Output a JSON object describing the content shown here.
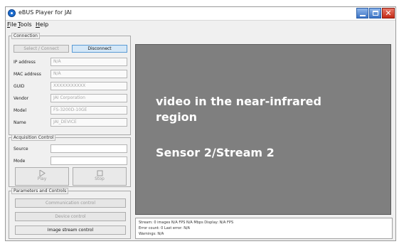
{
  "window": {
    "title": "eBUS Player for JAI"
  },
  "menu": {
    "file": "File",
    "tools": "Tools",
    "help": "Help"
  },
  "connection": {
    "title": "Connection",
    "select_connect": "Select / Connect",
    "disconnect": "Disconnect",
    "fields": [
      {
        "label": "IP address",
        "value": "N/A"
      },
      {
        "label": "MAC address",
        "value": "N/A"
      },
      {
        "label": "GUID",
        "value": "XXXXXXXXXXX"
      },
      {
        "label": "Vendor",
        "value": "JAI Corporation"
      },
      {
        "label": "Model",
        "value": "FS-3200D-10GE"
      },
      {
        "label": "Name",
        "value": "JAI_DEVICE"
      }
    ]
  },
  "acquisition": {
    "title": "Acquisition Control",
    "source_label": "Source",
    "source_value": "",
    "mode_label": "Mode",
    "mode_value": "",
    "play": "Play",
    "stop": "Stop"
  },
  "parameters": {
    "title": "Parameters and Controls",
    "communication": "Communication control",
    "device": "Device control",
    "image_stream": "Image stream control"
  },
  "display": {
    "line1": "video in the near-infrared",
    "line2": "region",
    "line3": "Sensor 2/Stream 2",
    "background": "#7f7f7f"
  },
  "status": {
    "line1": "Stream: 0 images   N/A FPS   N/A Mbps   Display: N/A FPS",
    "line2": "Error count: 0   Last error: N/A",
    "line3": "Warnings:  N/A"
  },
  "icons": {
    "app": "ebus-app-icon",
    "play": "play-icon",
    "stop": "stop-icon"
  }
}
